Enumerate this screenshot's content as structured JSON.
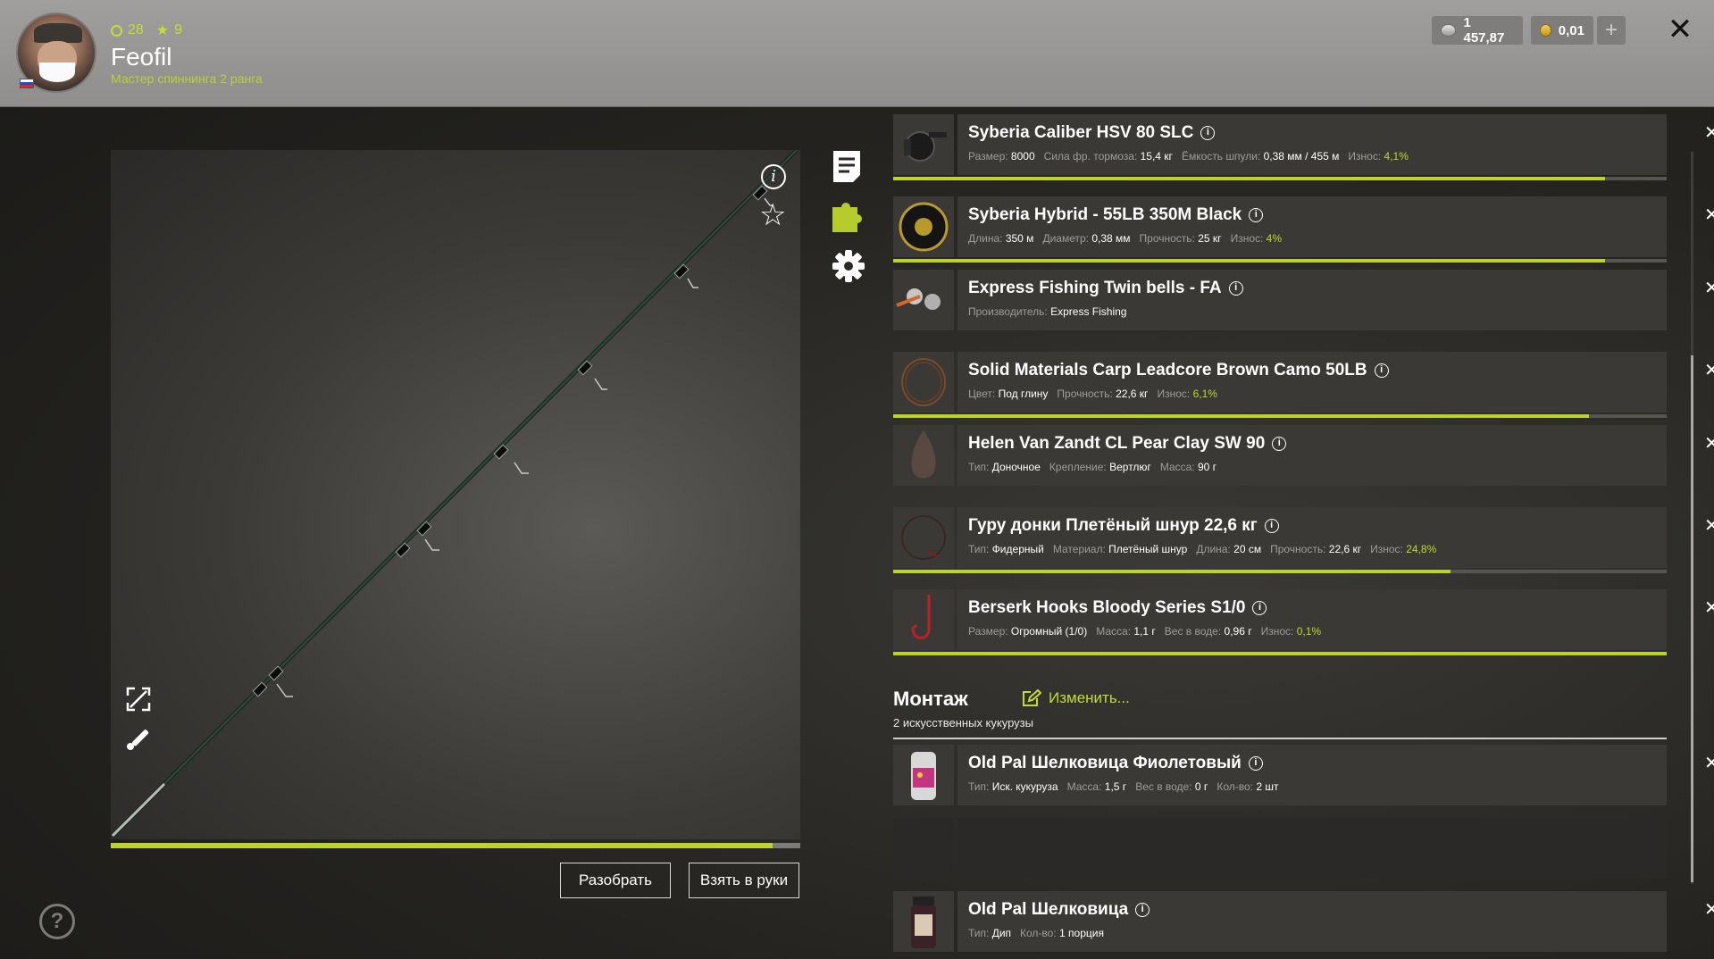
{
  "player": {
    "level": "28",
    "stars": "9",
    "name": "Feofil",
    "rank": "Мастер спиннинга 2 ранга"
  },
  "currency": {
    "silver": "1 457,87",
    "gold": "0,01",
    "add": "+"
  },
  "rod": {
    "wear_fraction": 0.96
  },
  "buttons": {
    "disassemble": "Разобрать",
    "take": "Взять в руки",
    "close": "✕",
    "help": "?"
  },
  "items": [
    {
      "title": "Syberia Caliber HSV 80 SLC",
      "stats": [
        {
          "label": "Размер:",
          "value": "8000"
        },
        {
          "label": "Сила фр. тормоза:",
          "value": "15,4 кг"
        },
        {
          "label": "Ёмкость шпули:",
          "value": "0,38 мм / 455 м"
        },
        {
          "label": "Износ:",
          "value": "4,1%",
          "wear": true
        }
      ],
      "wear": 0.92
    },
    {
      "title": "Syberia Hybrid - 55LB 350M Black",
      "stats": [
        {
          "label": "Длина:",
          "value": "350 м"
        },
        {
          "label": "Диаметр:",
          "value": "0,38 мм"
        },
        {
          "label": "Прочность:",
          "value": "25 кг"
        },
        {
          "label": "Износ:",
          "value": "4%",
          "wear": true
        }
      ],
      "wear": 0.92
    },
    {
      "title": "Express Fishing Twin bells - FA",
      "stats": [
        {
          "label": "Производитель:",
          "value": "Express Fishing"
        }
      ]
    },
    {
      "title": "Solid Materials Carp Leadcore Brown Camo 50LB",
      "stats": [
        {
          "label": "Цвет:",
          "value": "Под глину"
        },
        {
          "label": "Прочность:",
          "value": "22,6 кг"
        },
        {
          "label": "Износ:",
          "value": "6,1%",
          "wear": true
        }
      ],
      "wear": 0.9
    },
    {
      "title": "Helen Van Zandt CL Pear Clay SW 90",
      "stats": [
        {
          "label": "Тип:",
          "value": "Доночное"
        },
        {
          "label": "Крепление:",
          "value": "Вертлюг"
        },
        {
          "label": "Масса:",
          "value": "90 г"
        }
      ]
    },
    {
      "title": "Гуру донки Плетёный шнур 22,6 кг",
      "stats": [
        {
          "label": "Тип:",
          "value": "Фидерный"
        },
        {
          "label": "Материал:",
          "value": "Плетёный шнур"
        },
        {
          "label": "Длина:",
          "value": "20 см"
        },
        {
          "label": "Прочность:",
          "value": "22,6 кг"
        },
        {
          "label": "Износ:",
          "value": "24,8%",
          "wear": true
        }
      ],
      "wear": 0.72
    },
    {
      "title": "Berserk Hooks Bloody Series S1/0",
      "stats": [
        {
          "label": "Размер:",
          "value": "Огромный (1/0)"
        },
        {
          "label": "Масса:",
          "value": "1,1 г"
        },
        {
          "label": "Вес в воде:",
          "value": "0,96 г"
        },
        {
          "label": "Износ:",
          "value": "0,1%",
          "wear": true
        }
      ],
      "wear": 1.0
    }
  ],
  "montage": {
    "title": "Монтаж",
    "edit": "Изменить...",
    "subtitle": "2 искусственных кукурузы"
  },
  "baits": [
    {
      "title": "Old Pal Шелковица Фиолетовый",
      "stats": [
        {
          "label": "Тип:",
          "value": "Иск. кукуруза"
        },
        {
          "label": "Масса:",
          "value": "1,5 г"
        },
        {
          "label": "Вес в воде:",
          "value": "0 г"
        },
        {
          "label": "Кол-во:",
          "value": "2 шт"
        }
      ]
    },
    {
      "title": "Old Pal Шелковица",
      "stats": [
        {
          "label": "Тип:",
          "value": "Дип"
        },
        {
          "label": "Кол-во:",
          "value": "1 порция"
        }
      ]
    }
  ]
}
